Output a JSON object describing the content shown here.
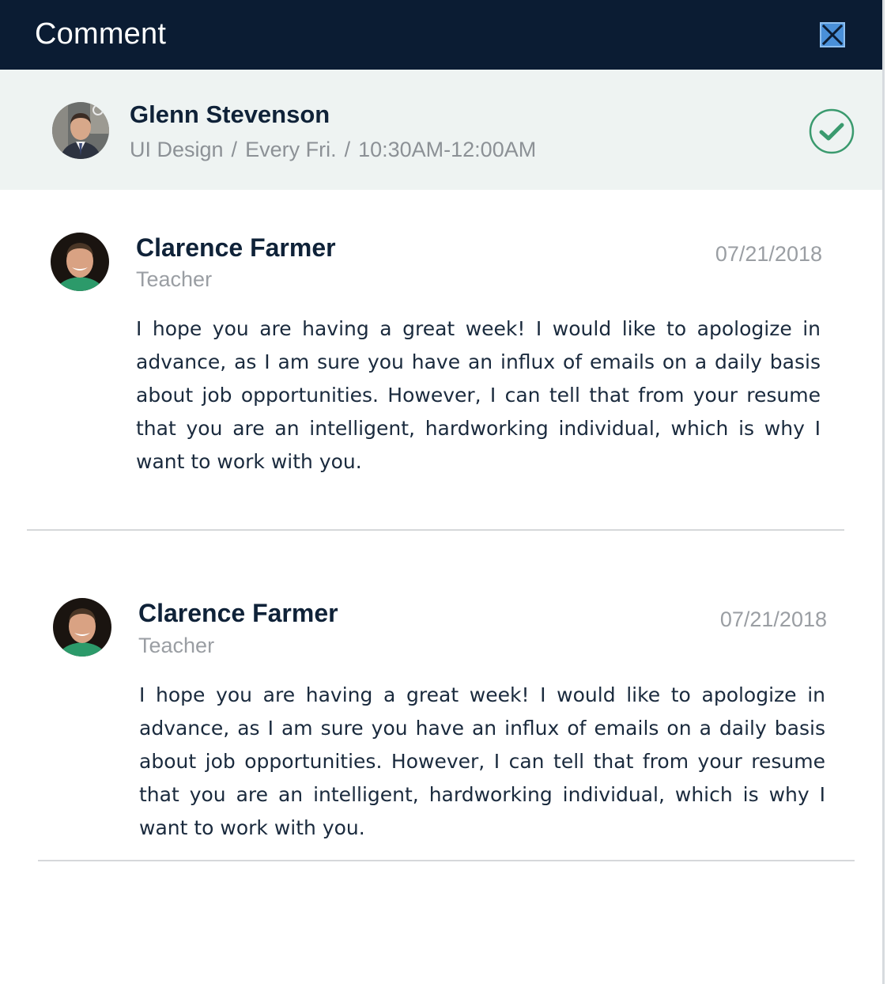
{
  "header": {
    "title": "Comment"
  },
  "session": {
    "name": "Glenn Stevenson",
    "course": "UI Design",
    "day": "Every Fri.",
    "time": "10:30AM-12:00AM",
    "separator": "/"
  },
  "comments": [
    {
      "author": "Clarence Farmer",
      "role": "Teacher",
      "date": "07/21/2018",
      "body": "I hope you are having a great week! I would like to apologize in advance, as I am sure you have an influx of emails on a daily basis about job opportunities. However, I can tell that from your resume that you are an intelligent, hardworking individual, which is why I want to work with you."
    },
    {
      "author": "Clarence Farmer",
      "role": "Teacher",
      "date": "07/21/2018",
      "body": "I hope you are having a great week! I would like to apologize in advance, as I am sure you have an influx of emails on a daily basis about job opportunities. However, I can tell that from your resume that you are an intelligent, hardworking individual, which is why I want to work with you."
    }
  ],
  "colors": {
    "header_bg": "#0b1c33",
    "session_bg": "#eef3f2",
    "accent_green": "#3a9a6e",
    "close_blue": "#4a90d9"
  }
}
